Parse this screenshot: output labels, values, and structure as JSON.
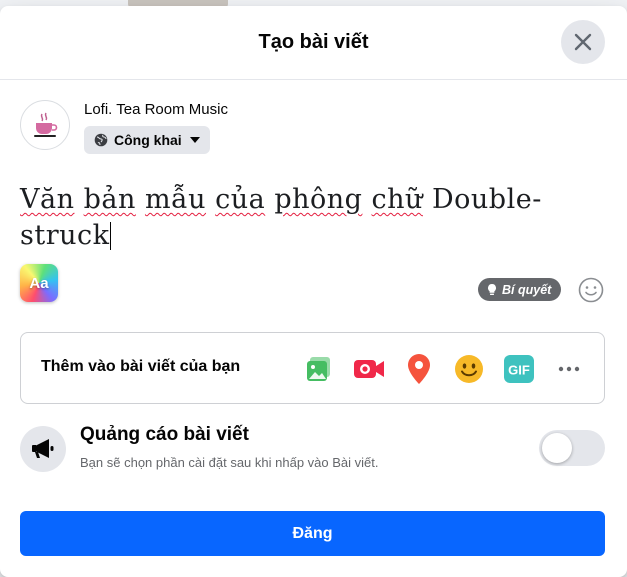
{
  "dialog": {
    "title": "Tạo bài viết"
  },
  "user": {
    "name": "Lofi. Tea Room Music",
    "privacy_label": "Công khai"
  },
  "post": {
    "words": [
      "Văn",
      "bản",
      "mẫu",
      "của",
      "phông",
      "chữ",
      "Double-struck"
    ],
    "misspelled": [
      "Văn",
      "bản",
      "mẫu",
      "của",
      "phông",
      "chữ"
    ]
  },
  "composer": {
    "font_button_label": "Aa",
    "tips_label": "Bí quyết"
  },
  "add_to_post": {
    "label": "Thêm vào bài viết của bạn",
    "icons": [
      "photo-video-icon",
      "live-video-icon",
      "location-pin-icon",
      "feeling-icon",
      "gif-icon",
      "more-icon"
    ],
    "gif_label": "GIF",
    "colors": {
      "photo": "#45bd62",
      "live": "#f02849",
      "location": "#f5533d",
      "feeling": "#f7b928",
      "gif": "#3ec2bf"
    }
  },
  "boost": {
    "title": "Quảng cáo bài viết",
    "subtitle": "Bạn sẽ chọn phần cài đặt sau khi nhấp vào Bài viết.",
    "enabled": false
  },
  "actions": {
    "post_label": "Đăng"
  },
  "theme": {
    "primary": "#0866ff",
    "surface": "#e4e6eb",
    "text": "#050505",
    "secondary_text": "#65676b"
  }
}
